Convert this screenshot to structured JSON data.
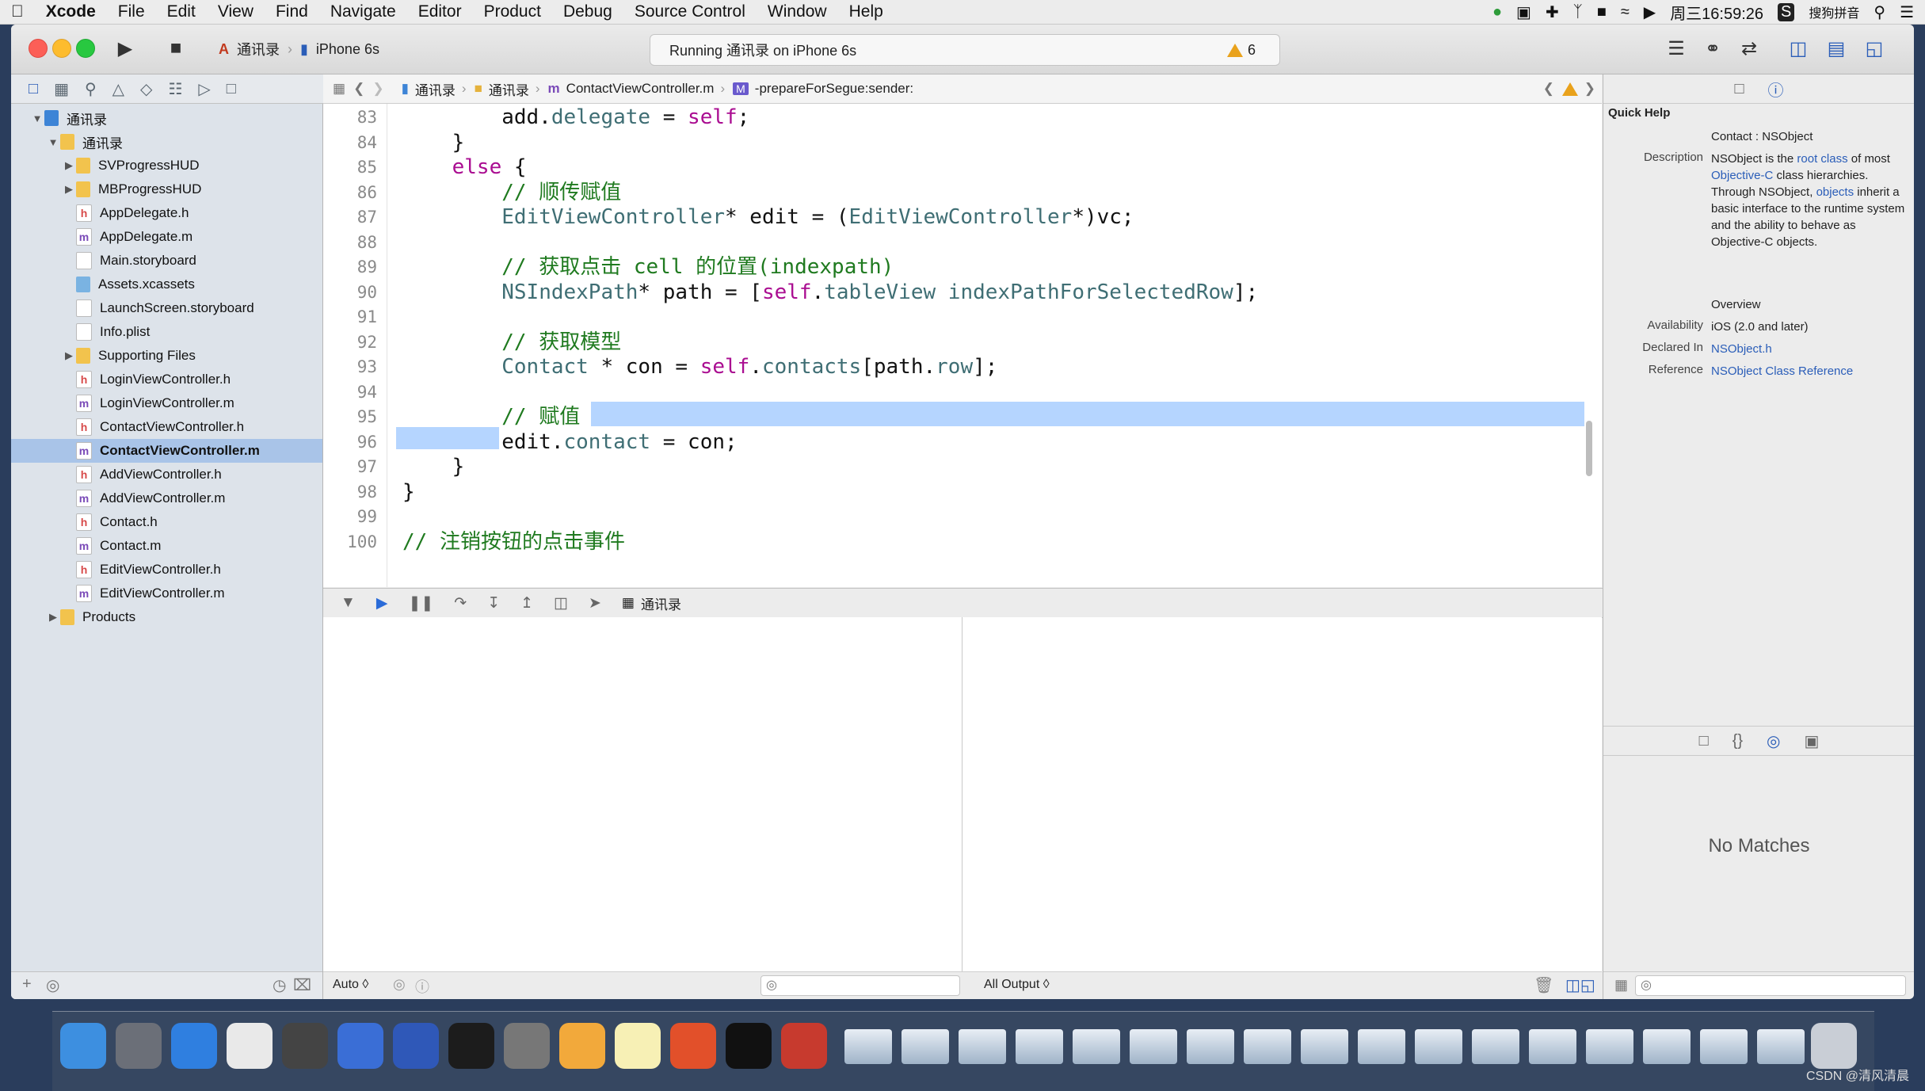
{
  "menubar": {
    "app": "Xcode",
    "items": [
      "File",
      "Edit",
      "View",
      "Find",
      "Navigate",
      "Editor",
      "Product",
      "Debug",
      "Source Control",
      "Window",
      "Help"
    ],
    "clock": "周三16:59:26",
    "input_method": "搜狗拼音"
  },
  "toolbar": {
    "scheme": "通讯录",
    "device": "iPhone 6s",
    "activity": "Running 通讯录 on iPhone 6s",
    "warnings": "6"
  },
  "navigator": {
    "items": [
      {
        "label": "通讯录",
        "type": "proj",
        "depth": 0,
        "disclosure": "open"
      },
      {
        "label": "通讯录",
        "type": "folder",
        "depth": 1,
        "disclosure": "open"
      },
      {
        "label": "SVProgressHUD",
        "type": "folder",
        "depth": 2,
        "disclosure": "closed"
      },
      {
        "label": "MBProgressHUD",
        "type": "folder",
        "depth": 2,
        "disclosure": "closed"
      },
      {
        "label": "AppDelegate.h",
        "type": "h",
        "depth": 2
      },
      {
        "label": "AppDelegate.m",
        "type": "m",
        "depth": 2
      },
      {
        "label": "Main.storyboard",
        "type": "sb",
        "depth": 2
      },
      {
        "label": "Assets.xcassets",
        "type": "as",
        "depth": 2
      },
      {
        "label": "LaunchScreen.storyboard",
        "type": "sb",
        "depth": 2
      },
      {
        "label": "Info.plist",
        "type": "pl",
        "depth": 2
      },
      {
        "label": "Supporting Files",
        "type": "folder",
        "depth": 2,
        "disclosure": "closed"
      },
      {
        "label": "LoginViewController.h",
        "type": "h",
        "depth": 2
      },
      {
        "label": "LoginViewController.m",
        "type": "m",
        "depth": 2
      },
      {
        "label": "ContactViewController.h",
        "type": "h",
        "depth": 2
      },
      {
        "label": "ContactViewController.m",
        "type": "m",
        "depth": 2,
        "selected": true
      },
      {
        "label": "AddViewController.h",
        "type": "h",
        "depth": 2
      },
      {
        "label": "AddViewController.m",
        "type": "m",
        "depth": 2
      },
      {
        "label": "Contact.h",
        "type": "h",
        "depth": 2
      },
      {
        "label": "Contact.m",
        "type": "m",
        "depth": 2
      },
      {
        "label": "EditViewController.h",
        "type": "h",
        "depth": 2
      },
      {
        "label": "EditViewController.m",
        "type": "m",
        "depth": 2
      },
      {
        "label": "Products",
        "type": "folder",
        "depth": 1,
        "disclosure": "closed"
      }
    ]
  },
  "jumpbar": {
    "path": [
      "通讯录",
      "通讯录",
      "ContactViewController.m",
      "-prepareForSegue:sender:"
    ],
    "method_badge": "M"
  },
  "editor": {
    "lines": [
      {
        "n": "83",
        "html": "        add.<span class=\"prop\">delegate</span> = <span class=\"kw\">self</span>;"
      },
      {
        "n": "84",
        "html": "    }"
      },
      {
        "n": "85",
        "html": "    <span class=\"kw\">else</span> {"
      },
      {
        "n": "86",
        "html": "        <span class=\"cm\">// 顺传赋值</span>"
      },
      {
        "n": "87",
        "html": "        <span class=\"cls\">EditViewController</span>* edit = (<span class=\"cls\">EditViewController</span>*)vc;"
      },
      {
        "n": "88",
        "html": ""
      },
      {
        "n": "89",
        "html": "        <span class=\"cm\">// 获取点击 cell 的位置(indexpath)</span>"
      },
      {
        "n": "90",
        "html": "        <span class=\"cls\">NSIndexPath</span>* path = [<span class=\"kw\">self</span>.<span class=\"prop\">tableView</span> <span class=\"cls\">indexPathForSelectedRow</span>];"
      },
      {
        "n": "91",
        "html": ""
      },
      {
        "n": "92",
        "html": "        <span class=\"cm\">// 获取模型</span>"
      },
      {
        "n": "93",
        "html": "        <span class=\"cls\">Contact</span> * con = <span class=\"kw\">self</span>.<span class=\"prop\">contacts</span>[path.<span class=\"prop\">row</span>];"
      },
      {
        "n": "94",
        "html": ""
      },
      {
        "n": "95",
        "html": "        <span class=\"cm\">// 赋值</span>"
      },
      {
        "n": "96",
        "html": "        edit.<span class=\"prop\">contact</span> = con;"
      },
      {
        "n": "97",
        "html": "    }"
      },
      {
        "n": "98",
        "html": "}"
      },
      {
        "n": "99",
        "html": ""
      },
      {
        "n": "100",
        "html": "<span class=\"cm\">// 注销按钮的点击事件</span>"
      }
    ]
  },
  "debug": {
    "process": "通讯录",
    "auto_label": "Auto ◊",
    "output_label": "All Output ◊"
  },
  "inspector": {
    "title": "Quick Help",
    "declaration": "Contact : NSObject",
    "description_parts": [
      "NSObject is the ",
      "root class",
      " of most ",
      "Objective-C",
      " class hierarchies. Through NSObject, ",
      "objects",
      " inherit a basic interface to the runtime system and the ability to behave as Objective-C objects."
    ],
    "overview": "Overview",
    "availability_label": "Availability",
    "availability": "iOS (2.0 and later)",
    "declared_label": "Declared In",
    "declared": "NSObject.h",
    "reference_label": "Reference",
    "reference": "NSObject Class Reference",
    "description_label": "Description",
    "no_matches": "No Matches"
  },
  "watermark": "CSDN @清风清晨"
}
